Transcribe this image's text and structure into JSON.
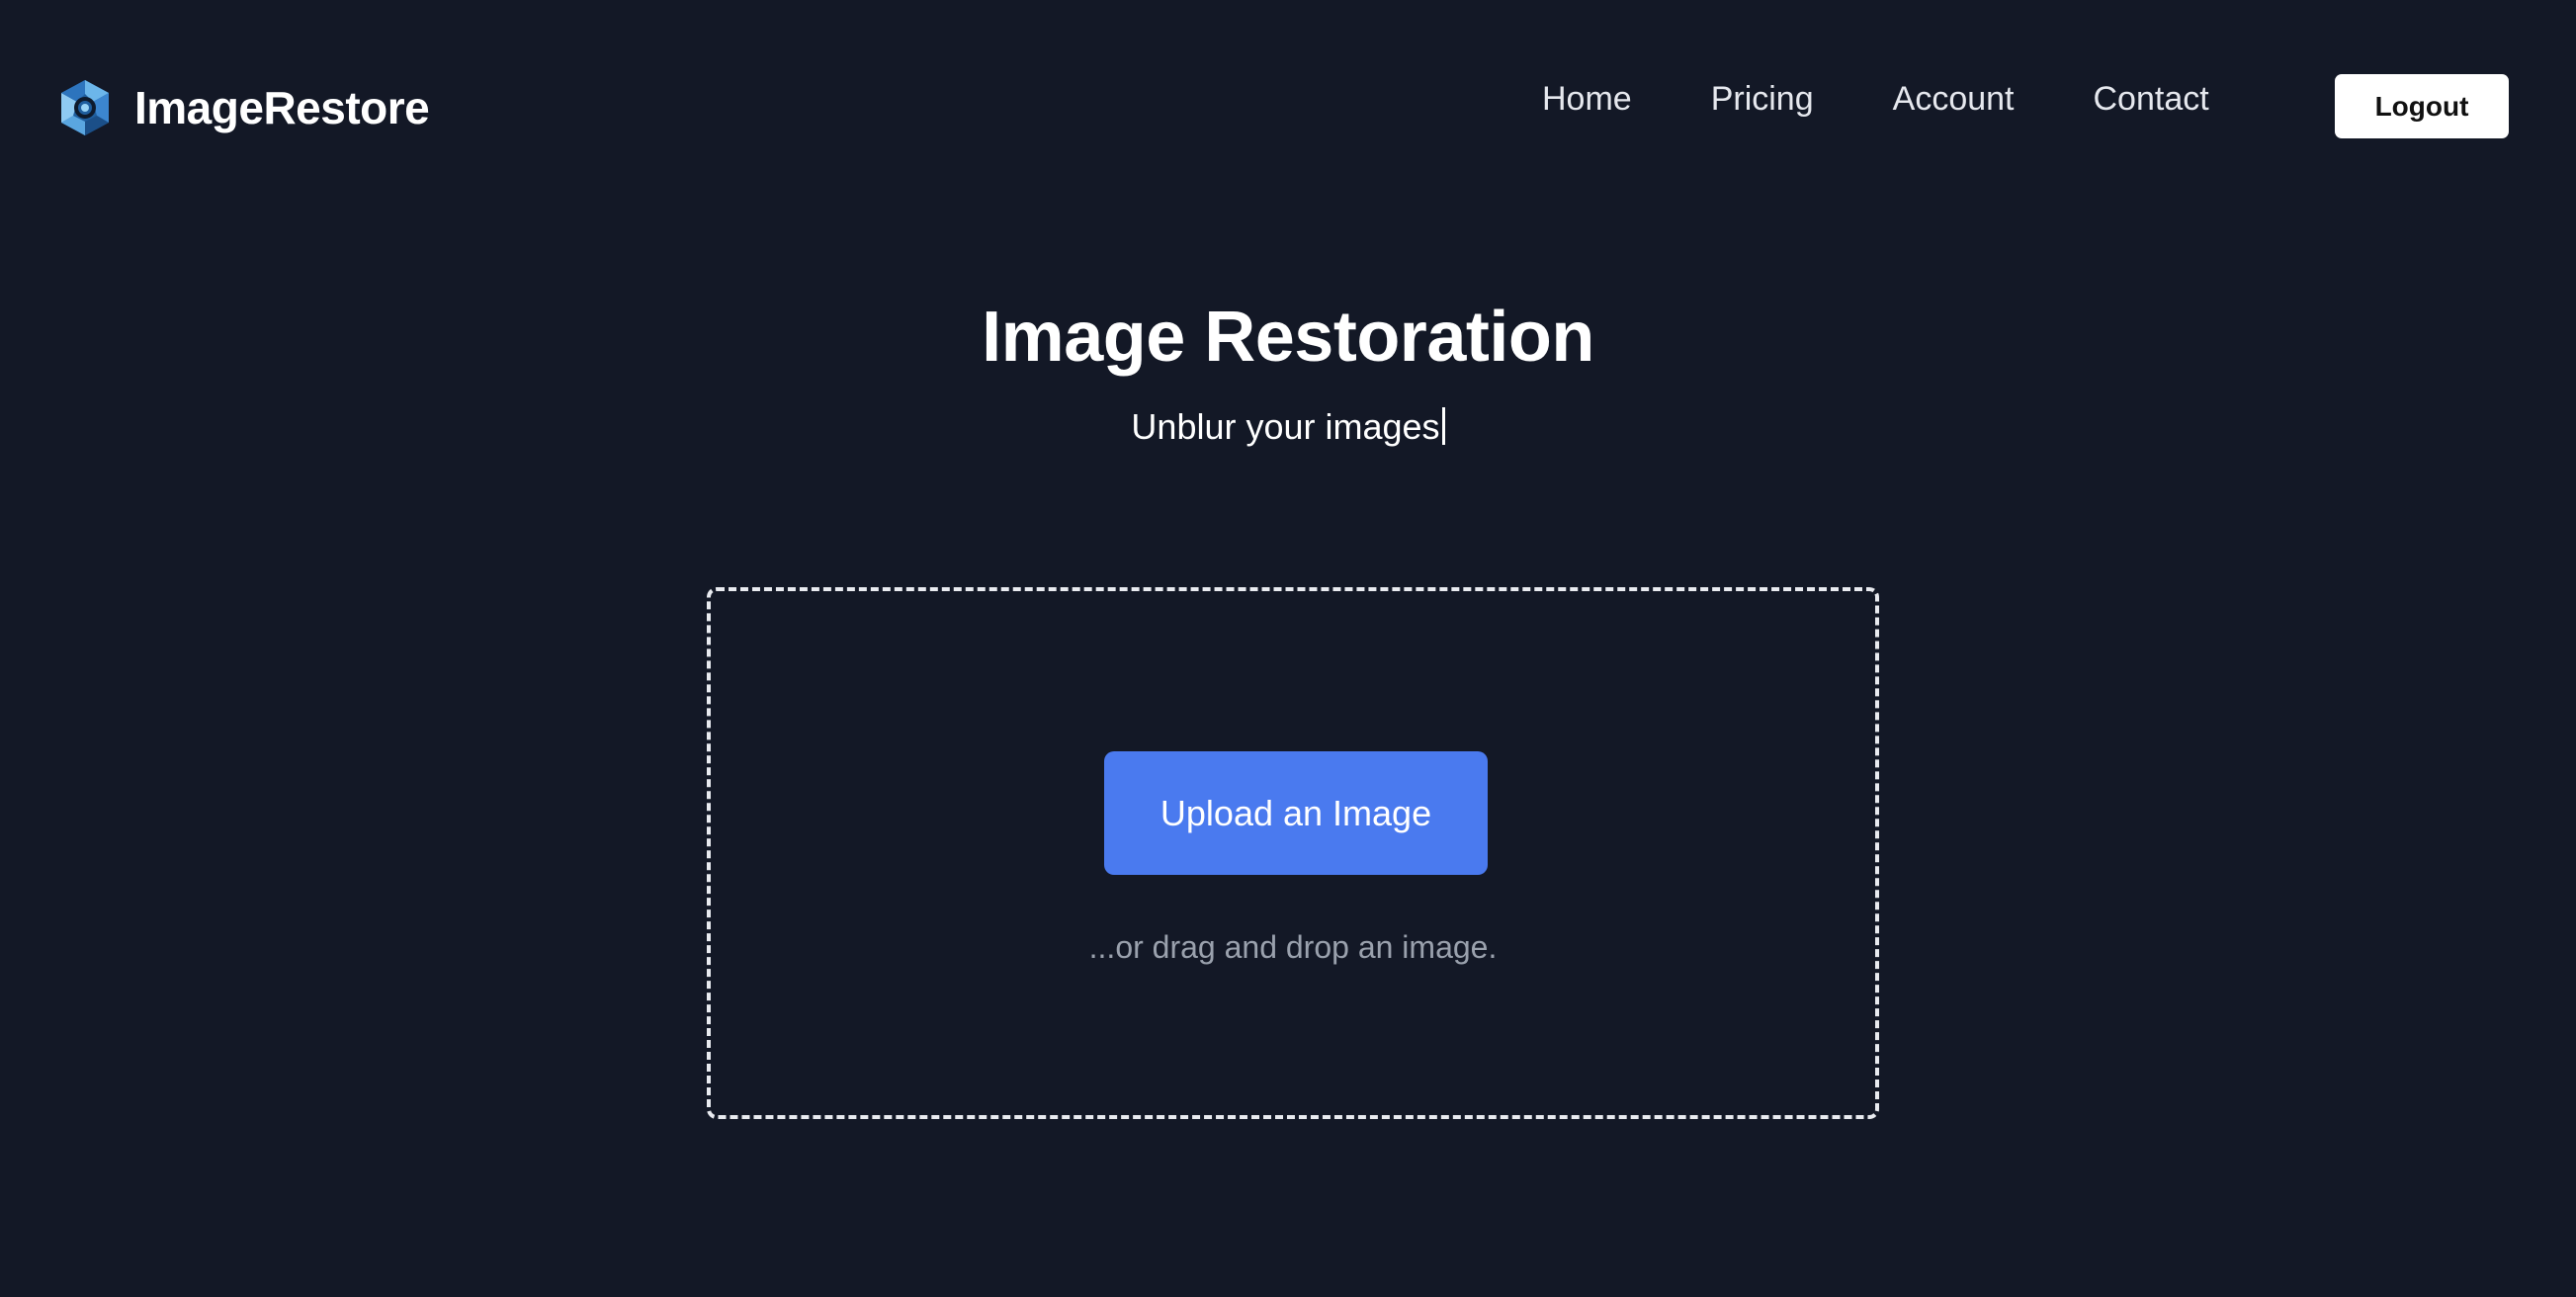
{
  "header": {
    "brand_name": "ImageRestore",
    "logo_icon": "hexagon-aperture-logo",
    "nav": [
      {
        "label": "Home"
      },
      {
        "label": "Pricing"
      },
      {
        "label": "Account"
      },
      {
        "label": "Contact"
      }
    ],
    "logout_label": "Logout"
  },
  "hero": {
    "title": "Image Restoration",
    "subtitle": "Unblur your images"
  },
  "dropzone": {
    "upload_label": "Upload an Image",
    "hint": "...or drag and drop an image."
  },
  "colors": {
    "background": "#131826",
    "accent": "#4a7aef",
    "hint_text": "#9aa1ad",
    "logo_blue": "#4a8fd6"
  }
}
